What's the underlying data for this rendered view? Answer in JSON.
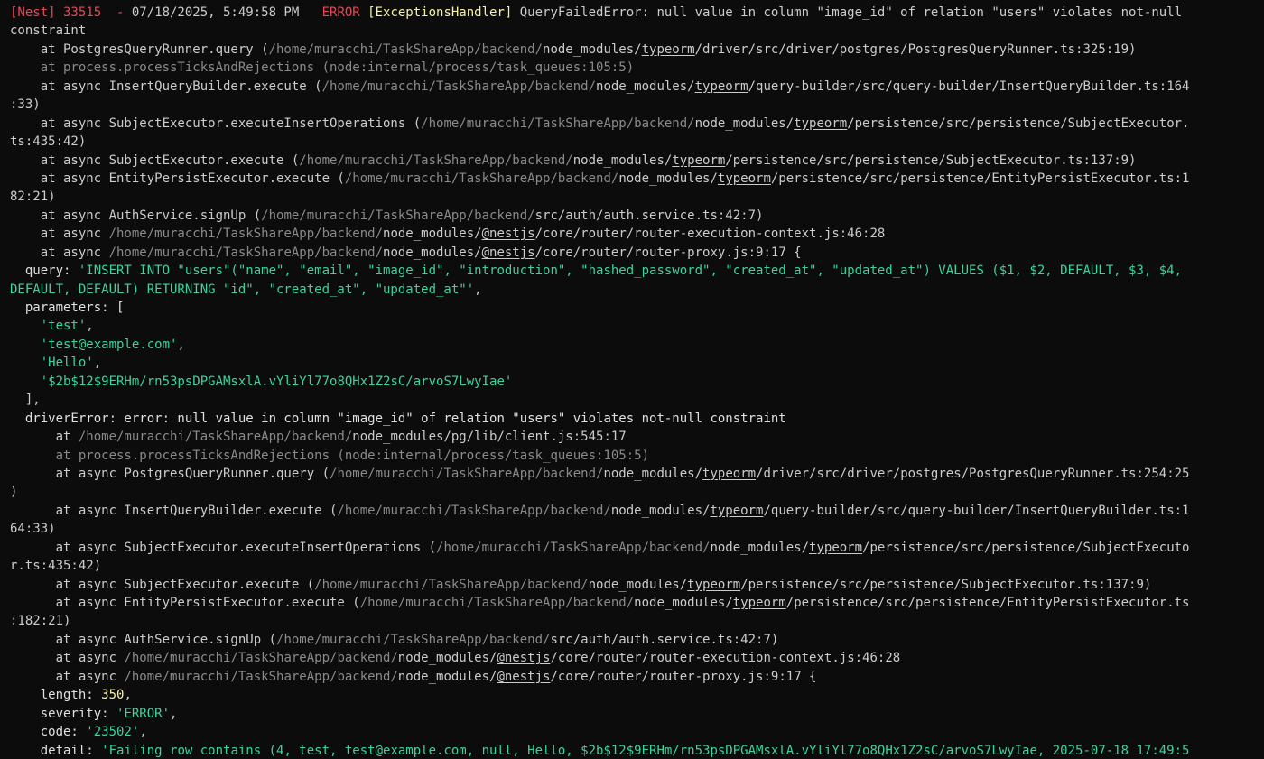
{
  "colors": {
    "background": "#0c0c0c",
    "default": "#cccccc",
    "red": "#e74856",
    "yellow": "#f9f1a5",
    "green": "#16c60c",
    "string": "#3ad4a0",
    "gray": "#8a8a8a",
    "key": "#e0e0e0"
  },
  "lines": [
    [
      {
        "t": "[Nest] 33515  - ",
        "c": "red"
      },
      {
        "t": "07/18/2025, 5:49:58 PM",
        "c": "default"
      },
      {
        "t": "   ERROR ",
        "c": "red"
      },
      {
        "t": "[ExceptionsHandler] ",
        "c": "yellow"
      },
      {
        "t": "QueryFailedError: null value in column \"image_id\" of relation \"users\" violates not-null",
        "c": "default"
      }
    ],
    [
      {
        "t": "constraint",
        "c": "default"
      }
    ],
    [
      {
        "t": "    at PostgresQueryRunner.query (",
        "c": "default"
      },
      {
        "t": "/home/muracchi/TaskShareApp/backend/",
        "c": "gray"
      },
      {
        "t": "node_modules/",
        "c": "default"
      },
      {
        "t": "typeorm",
        "c": "default",
        "u": true
      },
      {
        "t": "/driver/src/driver/postgres/PostgresQueryRunner.ts:325:19)",
        "c": "default"
      }
    ],
    [
      {
        "t": "    at process.processTicksAndRejections (node:internal/process/task_queues:105:5)",
        "c": "gray"
      }
    ],
    [
      {
        "t": "    at async InsertQueryBuilder.execute (",
        "c": "default"
      },
      {
        "t": "/home/muracchi/TaskShareApp/backend/",
        "c": "gray"
      },
      {
        "t": "node_modules/",
        "c": "default"
      },
      {
        "t": "typeorm",
        "c": "default",
        "u": true
      },
      {
        "t": "/query-builder/src/query-builder/InsertQueryBuilder.ts:164",
        "c": "default"
      }
    ],
    [
      {
        "t": ":33)",
        "c": "default"
      }
    ],
    [
      {
        "t": "    at async SubjectExecutor.executeInsertOperations (",
        "c": "default"
      },
      {
        "t": "/home/muracchi/TaskShareApp/backend/",
        "c": "gray"
      },
      {
        "t": "node_modules/",
        "c": "default"
      },
      {
        "t": "typeorm",
        "c": "default",
        "u": true
      },
      {
        "t": "/persistence/src/persistence/SubjectExecutor.",
        "c": "default"
      }
    ],
    [
      {
        "t": "ts:435:42)",
        "c": "default"
      }
    ],
    [
      {
        "t": "    at async SubjectExecutor.execute (",
        "c": "default"
      },
      {
        "t": "/home/muracchi/TaskShareApp/backend/",
        "c": "gray"
      },
      {
        "t": "node_modules/",
        "c": "default"
      },
      {
        "t": "typeorm",
        "c": "default",
        "u": true
      },
      {
        "t": "/persistence/src/persistence/SubjectExecutor.ts:137:9)",
        "c": "default"
      }
    ],
    [
      {
        "t": "    at async EntityPersistExecutor.execute (",
        "c": "default"
      },
      {
        "t": "/home/muracchi/TaskShareApp/backend/",
        "c": "gray"
      },
      {
        "t": "node_modules/",
        "c": "default"
      },
      {
        "t": "typeorm",
        "c": "default",
        "u": true
      },
      {
        "t": "/persistence/src/persistence/EntityPersistExecutor.ts:1",
        "c": "default"
      }
    ],
    [
      {
        "t": "82:21)",
        "c": "default"
      }
    ],
    [
      {
        "t": "    at async AuthService.signUp (",
        "c": "default"
      },
      {
        "t": "/home/muracchi/TaskShareApp/backend/",
        "c": "gray"
      },
      {
        "t": "src/auth/auth.service.ts:42:7)",
        "c": "default"
      }
    ],
    [
      {
        "t": "    at async ",
        "c": "default"
      },
      {
        "t": "/home/muracchi/TaskShareApp/backend/",
        "c": "gray"
      },
      {
        "t": "node_modules/",
        "c": "default"
      },
      {
        "t": "@nestjs",
        "c": "default",
        "u": true
      },
      {
        "t": "/core/router/router-execution-context.js:46:28",
        "c": "default"
      }
    ],
    [
      {
        "t": "    at async ",
        "c": "default"
      },
      {
        "t": "/home/muracchi/TaskShareApp/backend/",
        "c": "gray"
      },
      {
        "t": "node_modules/",
        "c": "default"
      },
      {
        "t": "@nestjs",
        "c": "default",
        "u": true
      },
      {
        "t": "/core/router/router-proxy.js:9:17 {",
        "c": "default"
      }
    ],
    [
      {
        "t": "  query: ",
        "c": "key"
      },
      {
        "t": "'INSERT INTO \"users\"(\"name\", \"email\", \"image_id\", \"introduction\", \"hashed_password\", \"created_at\", \"updated_at\") VALUES ($1, $2, DEFAULT, $3, $4,",
        "c": "string"
      }
    ],
    [
      {
        "t": "DEFAULT, DEFAULT) RETURNING \"id\", \"created_at\", \"updated_at\"'",
        "c": "string"
      },
      {
        "t": ",",
        "c": "default"
      }
    ],
    [
      {
        "t": "  parameters: [",
        "c": "key"
      }
    ],
    [
      {
        "t": "    ",
        "c": "default"
      },
      {
        "t": "'test'",
        "c": "string"
      },
      {
        "t": ",",
        "c": "default"
      }
    ],
    [
      {
        "t": "    ",
        "c": "default"
      },
      {
        "t": "'test@example.com'",
        "c": "string"
      },
      {
        "t": ",",
        "c": "default"
      }
    ],
    [
      {
        "t": "    ",
        "c": "default"
      },
      {
        "t": "'Hello'",
        "c": "string"
      },
      {
        "t": ",",
        "c": "default"
      }
    ],
    [
      {
        "t": "    ",
        "c": "default"
      },
      {
        "t": "'$2b$12$9ERHm/rn53psDPGAMsxlA.vYliYl77o8QHx1Z2sC/arvoS7LwyIae'",
        "c": "string"
      }
    ],
    [
      {
        "t": "  ],",
        "c": "default"
      }
    ],
    [
      {
        "t": "  driverError: error: null value in column \"image_id\" of relation \"users\" violates not-null constraint",
        "c": "key"
      }
    ],
    [
      {
        "t": "      at ",
        "c": "default"
      },
      {
        "t": "/home/muracchi/TaskShareApp/backend/",
        "c": "gray"
      },
      {
        "t": "node_modules/pg/lib/client.js:545:17",
        "c": "default"
      }
    ],
    [
      {
        "t": "      at process.processTicksAndRejections (node:internal/process/task_queues:105:5)",
        "c": "gray"
      }
    ],
    [
      {
        "t": "      at async PostgresQueryRunner.query (",
        "c": "default"
      },
      {
        "t": "/home/muracchi/TaskShareApp/backend/",
        "c": "gray"
      },
      {
        "t": "node_modules/",
        "c": "default"
      },
      {
        "t": "typeorm",
        "c": "default",
        "u": true
      },
      {
        "t": "/driver/src/driver/postgres/PostgresQueryRunner.ts:254:25",
        "c": "default"
      }
    ],
    [
      {
        "t": ")",
        "c": "default"
      }
    ],
    [
      {
        "t": "      at async InsertQueryBuilder.execute (",
        "c": "default"
      },
      {
        "t": "/home/muracchi/TaskShareApp/backend/",
        "c": "gray"
      },
      {
        "t": "node_modules/",
        "c": "default"
      },
      {
        "t": "typeorm",
        "c": "default",
        "u": true
      },
      {
        "t": "/query-builder/src/query-builder/InsertQueryBuilder.ts:1",
        "c": "default"
      }
    ],
    [
      {
        "t": "64:33)",
        "c": "default"
      }
    ],
    [
      {
        "t": "      at async SubjectExecutor.executeInsertOperations (",
        "c": "default"
      },
      {
        "t": "/home/muracchi/TaskShareApp/backend/",
        "c": "gray"
      },
      {
        "t": "node_modules/",
        "c": "default"
      },
      {
        "t": "typeorm",
        "c": "default",
        "u": true
      },
      {
        "t": "/persistence/src/persistence/SubjectExecuto",
        "c": "default"
      }
    ],
    [
      {
        "t": "r.ts:435:42)",
        "c": "default"
      }
    ],
    [
      {
        "t": "      at async SubjectExecutor.execute (",
        "c": "default"
      },
      {
        "t": "/home/muracchi/TaskShareApp/backend/",
        "c": "gray"
      },
      {
        "t": "node_modules/",
        "c": "default"
      },
      {
        "t": "typeorm",
        "c": "default",
        "u": true
      },
      {
        "t": "/persistence/src/persistence/SubjectExecutor.ts:137:9)",
        "c": "default"
      }
    ],
    [
      {
        "t": "      at async EntityPersistExecutor.execute (",
        "c": "default"
      },
      {
        "t": "/home/muracchi/TaskShareApp/backend/",
        "c": "gray"
      },
      {
        "t": "node_modules/",
        "c": "default"
      },
      {
        "t": "typeorm",
        "c": "default",
        "u": true
      },
      {
        "t": "/persistence/src/persistence/EntityPersistExecutor.ts",
        "c": "default"
      }
    ],
    [
      {
        "t": ":182:21)",
        "c": "default"
      }
    ],
    [
      {
        "t": "      at async AuthService.signUp (",
        "c": "default"
      },
      {
        "t": "/home/muracchi/TaskShareApp/backend/",
        "c": "gray"
      },
      {
        "t": "src/auth/auth.service.ts:42:7)",
        "c": "default"
      }
    ],
    [
      {
        "t": "      at async ",
        "c": "default"
      },
      {
        "t": "/home/muracchi/TaskShareApp/backend/",
        "c": "gray"
      },
      {
        "t": "node_modules/",
        "c": "default"
      },
      {
        "t": "@nestjs",
        "c": "default",
        "u": true
      },
      {
        "t": "/core/router/router-execution-context.js:46:28",
        "c": "default"
      }
    ],
    [
      {
        "t": "      at async ",
        "c": "default"
      },
      {
        "t": "/home/muracchi/TaskShareApp/backend/",
        "c": "gray"
      },
      {
        "t": "node_modules/",
        "c": "default"
      },
      {
        "t": "@nestjs",
        "c": "default",
        "u": true
      },
      {
        "t": "/core/router/router-proxy.js:9:17 {",
        "c": "default"
      }
    ],
    [
      {
        "t": "    length: ",
        "c": "key"
      },
      {
        "t": "350",
        "c": "yellow"
      },
      {
        "t": ",",
        "c": "default"
      }
    ],
    [
      {
        "t": "    severity: ",
        "c": "key"
      },
      {
        "t": "'ERROR'",
        "c": "string"
      },
      {
        "t": ",",
        "c": "default"
      }
    ],
    [
      {
        "t": "    code: ",
        "c": "key"
      },
      {
        "t": "'23502'",
        "c": "string"
      },
      {
        "t": ",",
        "c": "default"
      }
    ],
    [
      {
        "t": "    detail: ",
        "c": "key"
      },
      {
        "t": "'Failing row contains (4, test, test@example.com, null, Hello, $2b$12$9ERHm/rn53psDPGAMsxlA.vYliYl77o8QHx1Z2sC/arvoS7LwyIae, 2025-07-18 17:49:5",
        "c": "string"
      }
    ]
  ]
}
